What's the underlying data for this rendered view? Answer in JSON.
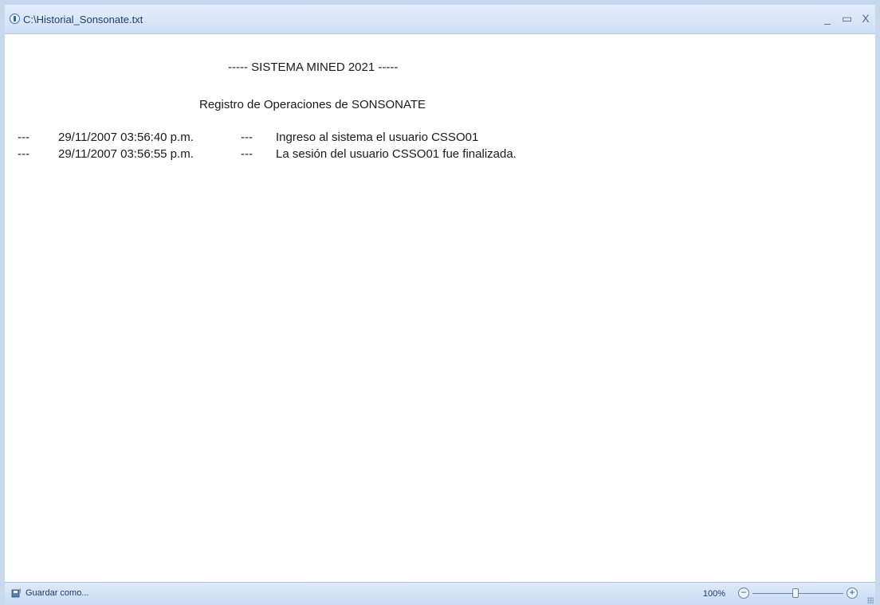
{
  "window": {
    "title": "C:\\Historial_Sonsonate.txt",
    "controls": {
      "minimize": "_",
      "maximize": "▭",
      "close": "X"
    }
  },
  "document": {
    "header": "----- SISTEMA MINED 2021 -----",
    "subheader": "Registro de Operaciones de SONSONATE",
    "entries": [
      {
        "prefix": "---",
        "timestamp": "29/11/2007 03:56:40 p.m.",
        "separator": "---",
        "message": "Ingreso al sistema el usuario CSSO01"
      },
      {
        "prefix": "---",
        "timestamp": "29/11/2007 03:56:55 p.m.",
        "separator": "---",
        "message": "La sesión del usuario CSSO01 fue finalizada."
      }
    ]
  },
  "statusbar": {
    "save_label": "Guardar como...",
    "zoom_level": "100%",
    "zoom_out_symbol": "−",
    "zoom_in_symbol": "+"
  }
}
